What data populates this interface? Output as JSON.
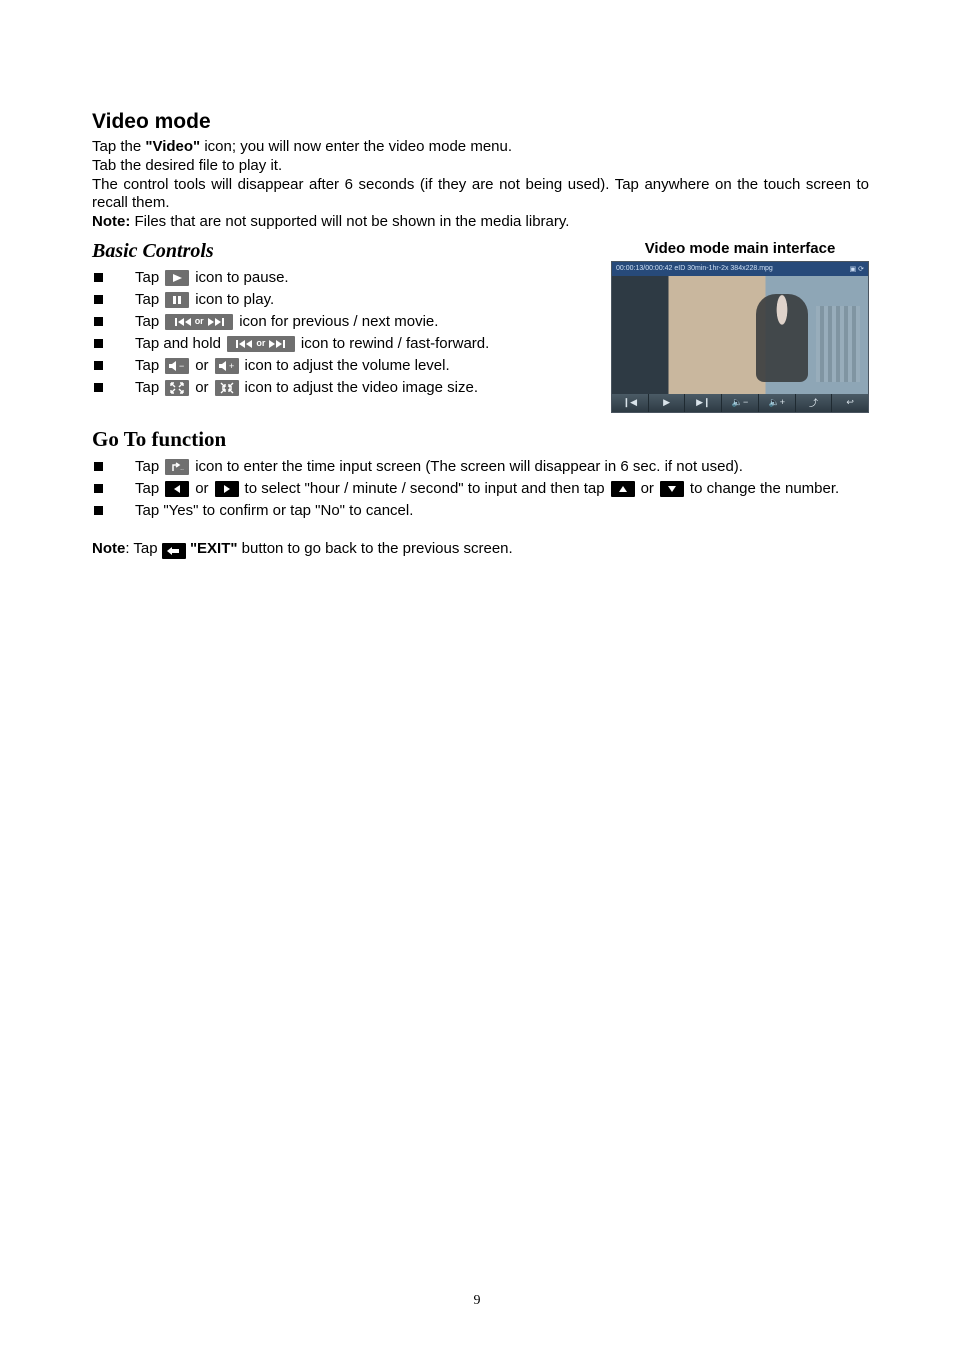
{
  "page_number": "9",
  "heading1": "Video mode",
  "intro": {
    "l1a": "Tap the ",
    "l1b": "\"Video\"",
    "l1c": " icon; you will now enter the video mode menu.",
    "l2": "Tab the desired file to play it.",
    "l3": "The control tools will disappear after 6 seconds (if they are not being used). Tap anywhere on the touch screen to recall them.",
    "note_label": "Note:",
    "note_text": " Files that are not supported will not be shown in the media library."
  },
  "caption_video_iface": "Video mode main interface",
  "heading_basic": "Basic Controls",
  "basic": {
    "tap": "Tap ",
    "tap_hold": "Tap and hold ",
    "or_word": " or ",
    "b1_suffix": " icon to pause.",
    "b2_suffix": " icon to play.",
    "b3_suffix": " icon for previous / next movie.",
    "b4_suffix": " icon to rewind / fast-forward.",
    "b5_suffix": "  icon to adjust the volume level.",
    "b6_suffix": " icon to adjust the video image size."
  },
  "heading_goto": "Go To function",
  "goto": {
    "g1_suffix": " icon to enter the time input screen (The screen will disappear in 6 sec. if not used).",
    "g2_mid1": " to select \"hour / minute / second\" to input and then tap ",
    "g2_end": " to change the number.",
    "g3": "Tap \"Yes\" to confirm or tap \"No\" to cancel."
  },
  "final_note": {
    "label": "Note",
    "colon_tap": ": Tap ",
    "exit_quote": " \"EXIT\"",
    "suffix": " button to go back to the previous screen."
  },
  "thumb_top_left": "00:00:13/00:00:42   eID 30min-1hr-2x  384x228.mpg",
  "icons_or": "or"
}
